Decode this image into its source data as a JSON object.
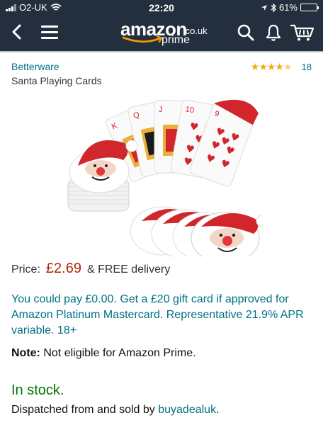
{
  "status_bar": {
    "carrier": "O2-UK",
    "time": "22:20",
    "battery": "61%",
    "battery_level": 0.61
  },
  "header": {
    "logo_text": "amazon",
    "logo_tld": ".co.uk",
    "logo_sub": "prime",
    "icons": [
      "back-icon",
      "menu-icon",
      "search-icon",
      "bell-icon",
      "cart-icon"
    ]
  },
  "product": {
    "brand": "Betterware",
    "title": "Santa Playing Cards",
    "rating": 4.5,
    "review_count": "18",
    "price_label": "Price:",
    "price": "£2.69",
    "delivery": "& FREE delivery",
    "offer": "You could pay £0.00. Get a £20 gift card if approved for Amazon Platinum Mastercard. Representative 21.9% APR variable. 18+",
    "note_label": "Note:",
    "note_text": "Not eligible for Amazon Prime.",
    "stock": "In stock.",
    "dispatch_prefix": "Dispatched from and sold by",
    "seller": "buyadealuk",
    "dispatch_suffix": "."
  },
  "colors": {
    "header_bg": "#232f3e",
    "link": "#007185",
    "price": "#b12704",
    "stock": "#007600",
    "star": "#f2a81a"
  }
}
